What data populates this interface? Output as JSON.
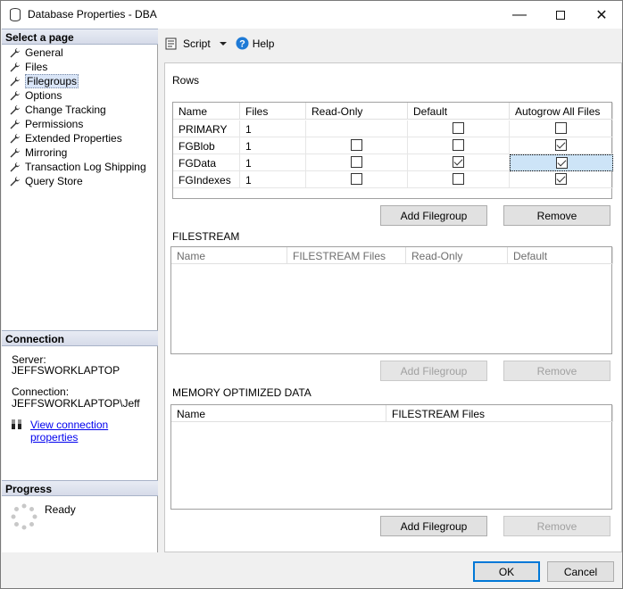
{
  "window": {
    "title": "Database Properties - DBA",
    "min_glyph": "—",
    "max_glyph": "☐",
    "close_glyph": "✕"
  },
  "left": {
    "select_page_header": "Select a page",
    "nav": [
      "General",
      "Files",
      "Filegroups",
      "Options",
      "Change Tracking",
      "Permissions",
      "Extended Properties",
      "Mirroring",
      "Transaction Log Shipping",
      "Query Store"
    ],
    "selected_index": 2,
    "connection_header": "Connection",
    "server_label": "Server:",
    "server_value": "JEFFSWORKLAPTOP",
    "connection_label": "Connection:",
    "connection_value": "JEFFSWORKLAPTOP\\Jeff",
    "view_conn_link": "View connection properties",
    "progress_header": "Progress",
    "progress_status": "Ready"
  },
  "toolbar": {
    "script_label": "Script",
    "help_label": "Help"
  },
  "rows_section": {
    "title": "Rows",
    "columns": [
      "Name",
      "Files",
      "Read-Only",
      "Default",
      "Autogrow All Files"
    ],
    "rows": [
      {
        "name": "PRIMARY",
        "files": "1",
        "read_only": null,
        "default": false,
        "autogrow": false
      },
      {
        "name": "FGBlob",
        "files": "1",
        "read_only": false,
        "default": false,
        "autogrow": true
      },
      {
        "name": "FGData",
        "files": "1",
        "read_only": false,
        "default": true,
        "autogrow": true
      },
      {
        "name": "FGIndexes",
        "files": "1",
        "read_only": false,
        "default": false,
        "autogrow": true
      }
    ],
    "add_button": "Add Filegroup",
    "remove_button": "Remove"
  },
  "filestream_section": {
    "title": "FILESTREAM",
    "columns": [
      "Name",
      "FILESTREAM Files",
      "Read-Only",
      "Default"
    ],
    "add_button": "Add Filegroup",
    "remove_button": "Remove"
  },
  "memory_section": {
    "title": "MEMORY OPTIMIZED DATA",
    "columns": [
      "Name",
      "FILESTREAM Files"
    ],
    "add_button": "Add Filegroup",
    "remove_button": "Remove"
  },
  "footer": {
    "ok_button": "OK",
    "cancel_button": "Cancel"
  }
}
